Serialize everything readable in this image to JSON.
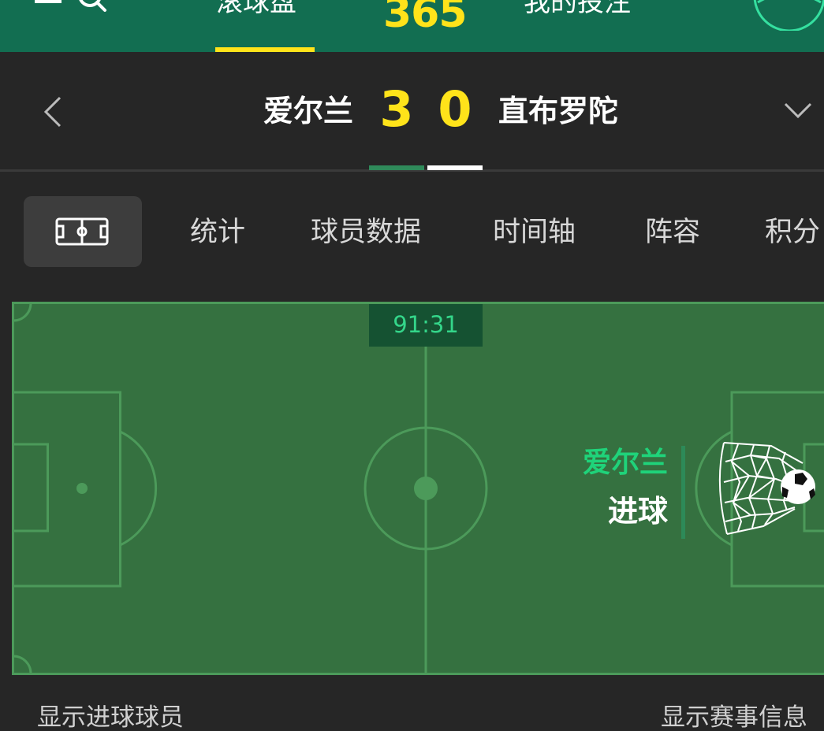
{
  "header": {
    "tabs": [
      {
        "label": "滚球盘"
      },
      {
        "label": "我的投注"
      }
    ],
    "logo": "365"
  },
  "match": {
    "home_team": "爱尔兰",
    "away_team": "直布罗陀",
    "home_score": "3",
    "away_score": "0"
  },
  "subnav": {
    "tabs": [
      {
        "label": "统计"
      },
      {
        "label": "球员数据"
      },
      {
        "label": "时间轴"
      },
      {
        "label": "阵容"
      },
      {
        "label": "积分"
      }
    ]
  },
  "pitch": {
    "clock": "91:31",
    "event_team": "爱尔兰",
    "event_type": "进球"
  },
  "footer": {
    "show_scorers": "显示进球球员",
    "show_info": "显示赛事信息"
  },
  "colors": {
    "header_green": "#126e51",
    "accent_yellow": "#ffe31a",
    "pitch_green": "#357140",
    "event_green": "#1fd37a"
  },
  "icons": [
    "menu-icon",
    "search-icon",
    "ball-icon",
    "back-icon",
    "chevron-down-icon",
    "field-icon",
    "goal-net-icon"
  ]
}
